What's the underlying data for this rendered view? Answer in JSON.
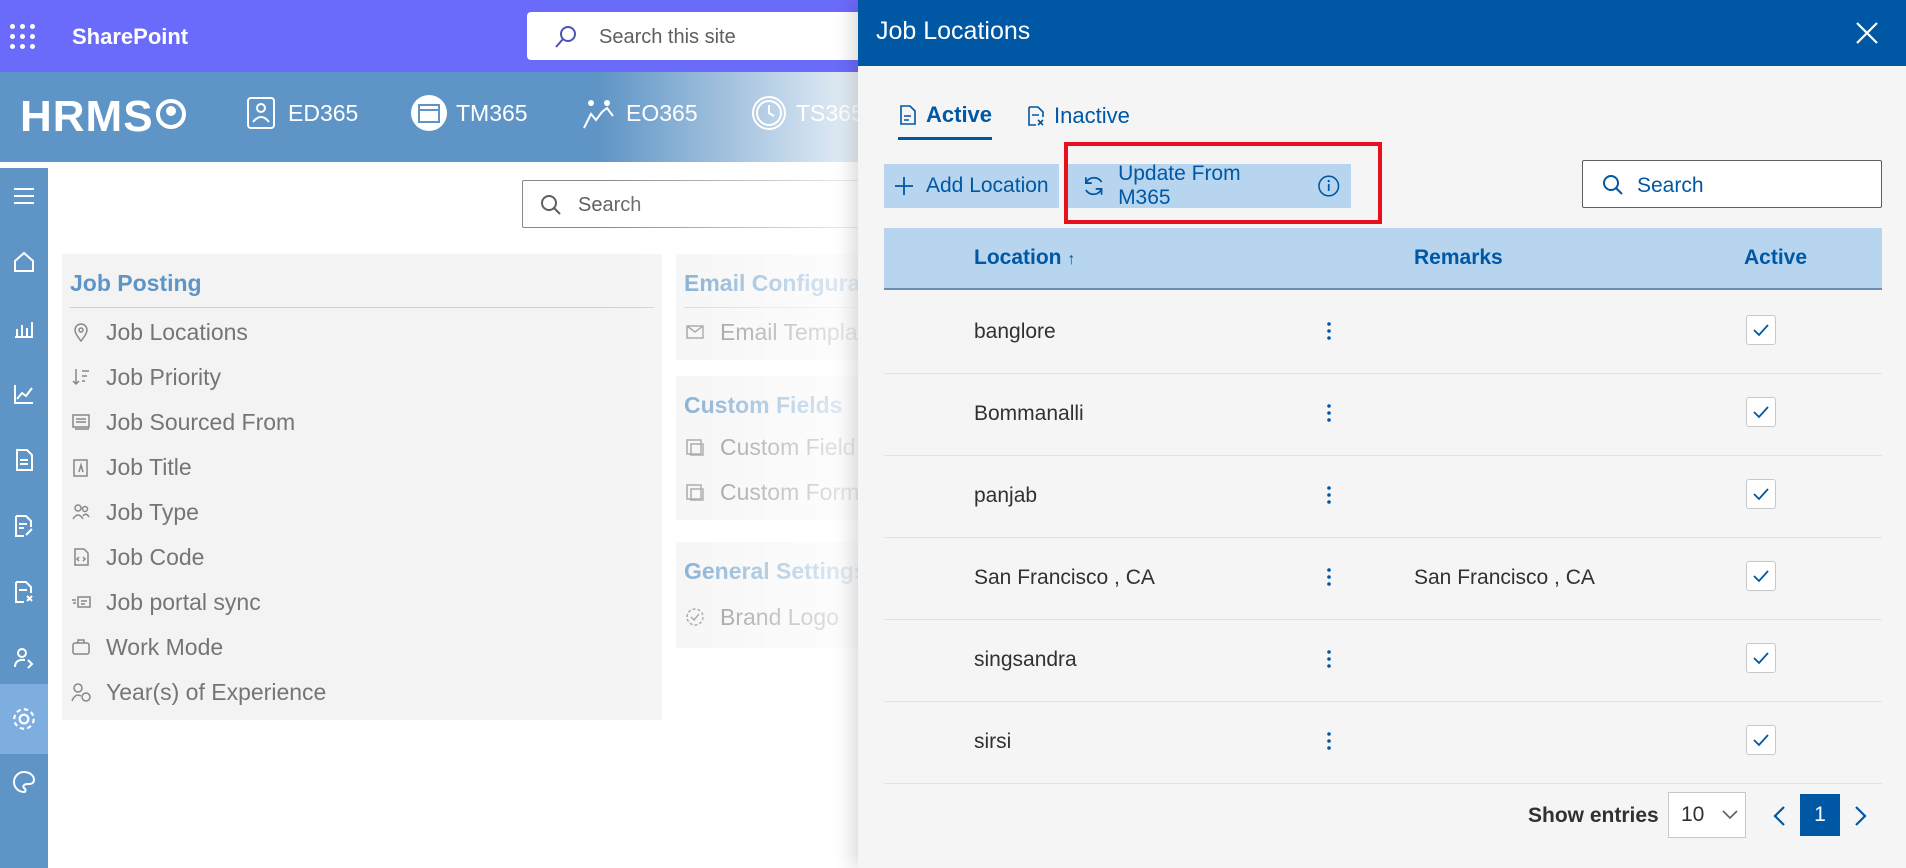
{
  "suite": {
    "brand": "SharePoint",
    "search_placeholder": "Search this site"
  },
  "app": {
    "logo": "HRMS",
    "nav": [
      {
        "label": "ED365",
        "icon": "employee-directory-icon"
      },
      {
        "label": "TM365",
        "icon": "calendar-icon"
      },
      {
        "label": "EO365",
        "icon": "onboarding-icon"
      },
      {
        "label": "TS365",
        "icon": "clock-icon"
      }
    ]
  },
  "rail": {
    "items": [
      "menu-icon",
      "home-icon",
      "bar-chart-icon",
      "line-chart-icon",
      "document-icon",
      "document-edit-icon",
      "document-remove-icon",
      "user-settings-icon",
      "gear-icon",
      "palette-icon"
    ]
  },
  "main": {
    "search_placeholder": "Search",
    "job_posting": {
      "title": "Job Posting",
      "items": [
        "Job Locations",
        "Job Priority",
        "Job Sourced From",
        "Job Title",
        "Job Type",
        "Job Code",
        "Job portal sync",
        "Work Mode",
        "Year(s) of Experience"
      ]
    },
    "email_config": {
      "title": "Email Configura",
      "items": [
        "Email Templa"
      ]
    },
    "custom_fields": {
      "title": "Custom Fields",
      "items": [
        "Custom Field",
        "Custom Form"
      ]
    },
    "general_settings": {
      "title": "General Settings",
      "items": [
        "Brand Logo"
      ]
    }
  },
  "panel": {
    "title": "Job Locations",
    "tabs": [
      {
        "label": "Active",
        "selected": true
      },
      {
        "label": "Inactive",
        "selected": false
      }
    ],
    "buttons": {
      "add": "Add Location",
      "update": "Update From M365"
    },
    "search_placeholder": "Search",
    "columns": {
      "location": "Location",
      "remarks": "Remarks",
      "active": "Active"
    },
    "rows": [
      {
        "location": "banglore",
        "remarks": "",
        "active": true
      },
      {
        "location": "Bommanalli",
        "remarks": "",
        "active": true
      },
      {
        "location": "panjab",
        "remarks": "",
        "active": true
      },
      {
        "location": "San Francisco , CA",
        "remarks": "San Francisco , CA",
        "active": true
      },
      {
        "location": "singsandra",
        "remarks": "",
        "active": true
      },
      {
        "location": "sirsi",
        "remarks": "",
        "active": true
      }
    ],
    "footer": {
      "show_entries_label": "Show entries",
      "page_size": "10",
      "current_page": "1"
    }
  },
  "colors": {
    "suite_bar": "#6b6bfb",
    "app_blue": "#5f95c6",
    "panel_header": "#0057a3",
    "highlight": "#e8101c"
  }
}
